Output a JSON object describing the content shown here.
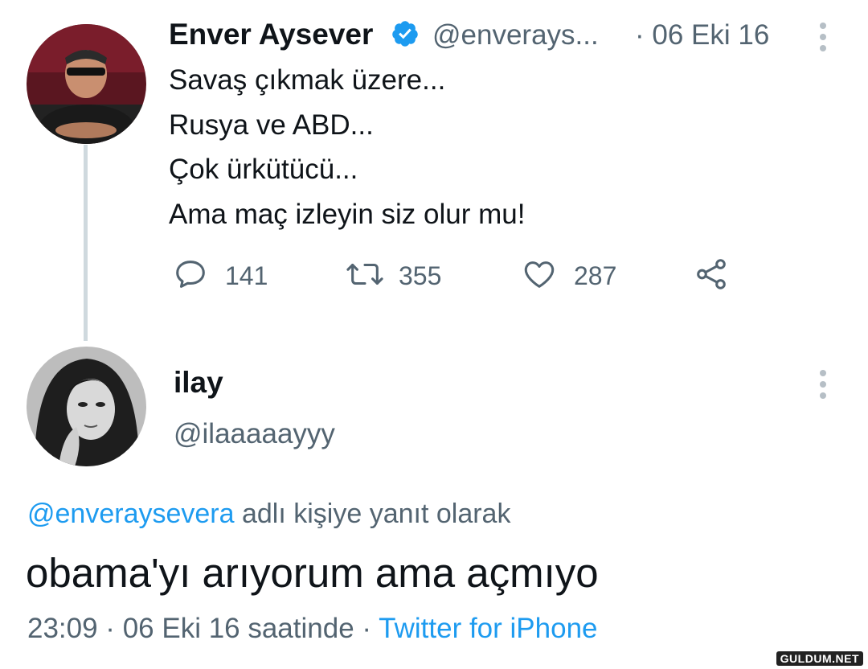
{
  "tweet": {
    "author_name": "Enver Aysever",
    "handle": "@enverays...",
    "date": "· 06 Eki 16",
    "lines": [
      "Savaş çıkmak üzere...",
      "Rusya ve ABD...",
      "Çok ürkütücü...",
      "Ama maç izleyin siz olur mu!"
    ],
    "replies": "141",
    "retweets": "355",
    "likes": "287"
  },
  "reply": {
    "author_name": "ilay",
    "handle": "@ilaaaaayyy",
    "reply_mention": "@enveraysevera",
    "reply_suffix": " adlı kişiye yanıt olarak",
    "text": "obama'yı arıyorum ama açmıyo",
    "time_date": "23:09 · 06 Eki 16 saatinde · ",
    "source_app": "Twitter for iPhone"
  },
  "watermark": "GULDUM.NET",
  "colors": {
    "accent": "#1d9bf0",
    "secondary_text": "#536471",
    "primary_text": "#0f1419"
  },
  "icons": {
    "verified": "verified-badge-icon",
    "more": "more-vertical-icon",
    "reply": "reply-bubble-icon",
    "retweet": "retweet-icon",
    "like": "heart-icon",
    "share": "share-icon"
  }
}
